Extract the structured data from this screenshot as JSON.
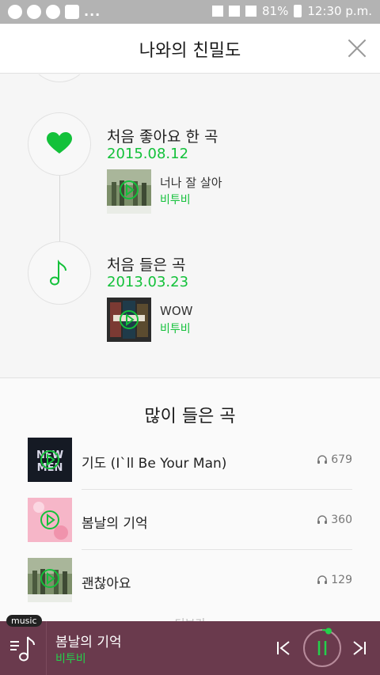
{
  "status": {
    "battery": "81%",
    "time": "12:30 p.m.",
    "dots": "..."
  },
  "header": {
    "title": "나와의 친밀도"
  },
  "timeline": {
    "events": [
      {
        "title": "처음 좋아요 한 곡",
        "date": "2015.08.12",
        "song": "너나 잘 살아",
        "artist": "비투비",
        "icon": "heart-icon"
      },
      {
        "title": "처음 들은 곡",
        "date": "2013.03.23",
        "song": "WOW",
        "artist": "비투비",
        "icon": "music-note-icon"
      }
    ]
  },
  "most_played": {
    "title": "많이 들은 곡",
    "items": [
      {
        "title": "기도 (I`ll Be Your Man)",
        "count": "679"
      },
      {
        "title": "봄날의 기억",
        "count": "360"
      },
      {
        "title": "괜찮아요",
        "count": "129"
      }
    ],
    "more_label": "더보기"
  },
  "player": {
    "tag": "music",
    "title": "봄날의 기억",
    "artist": "비투비"
  },
  "colors": {
    "accent": "#13c13a",
    "player_bg": "#6a3a4d"
  }
}
